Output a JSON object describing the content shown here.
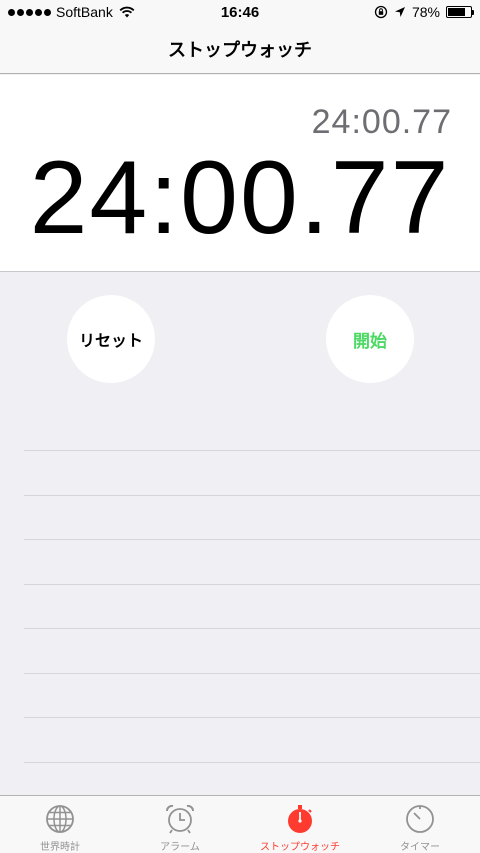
{
  "status_bar": {
    "carrier": "SoftBank",
    "time": "16:46",
    "battery": "78%",
    "battery_level": 0.78
  },
  "nav": {
    "title": "ストップウォッチ"
  },
  "stopwatch": {
    "lap_time": "24:00.77",
    "main_time": "24:00.77"
  },
  "buttons": {
    "reset_label": "リセット",
    "start_label": "開始"
  },
  "tabs": [
    {
      "label": "世界時計",
      "icon": "globe-icon"
    },
    {
      "label": "アラーム",
      "icon": "alarm-clock-icon"
    },
    {
      "label": "ストップウォッチ",
      "icon": "stopwatch-icon",
      "active": true
    },
    {
      "label": "タイマー",
      "icon": "timer-icon"
    }
  ],
  "colors": {
    "accent_red": "#ff3b30",
    "start_green": "#4cd964",
    "inactive_gray": "#929292"
  }
}
